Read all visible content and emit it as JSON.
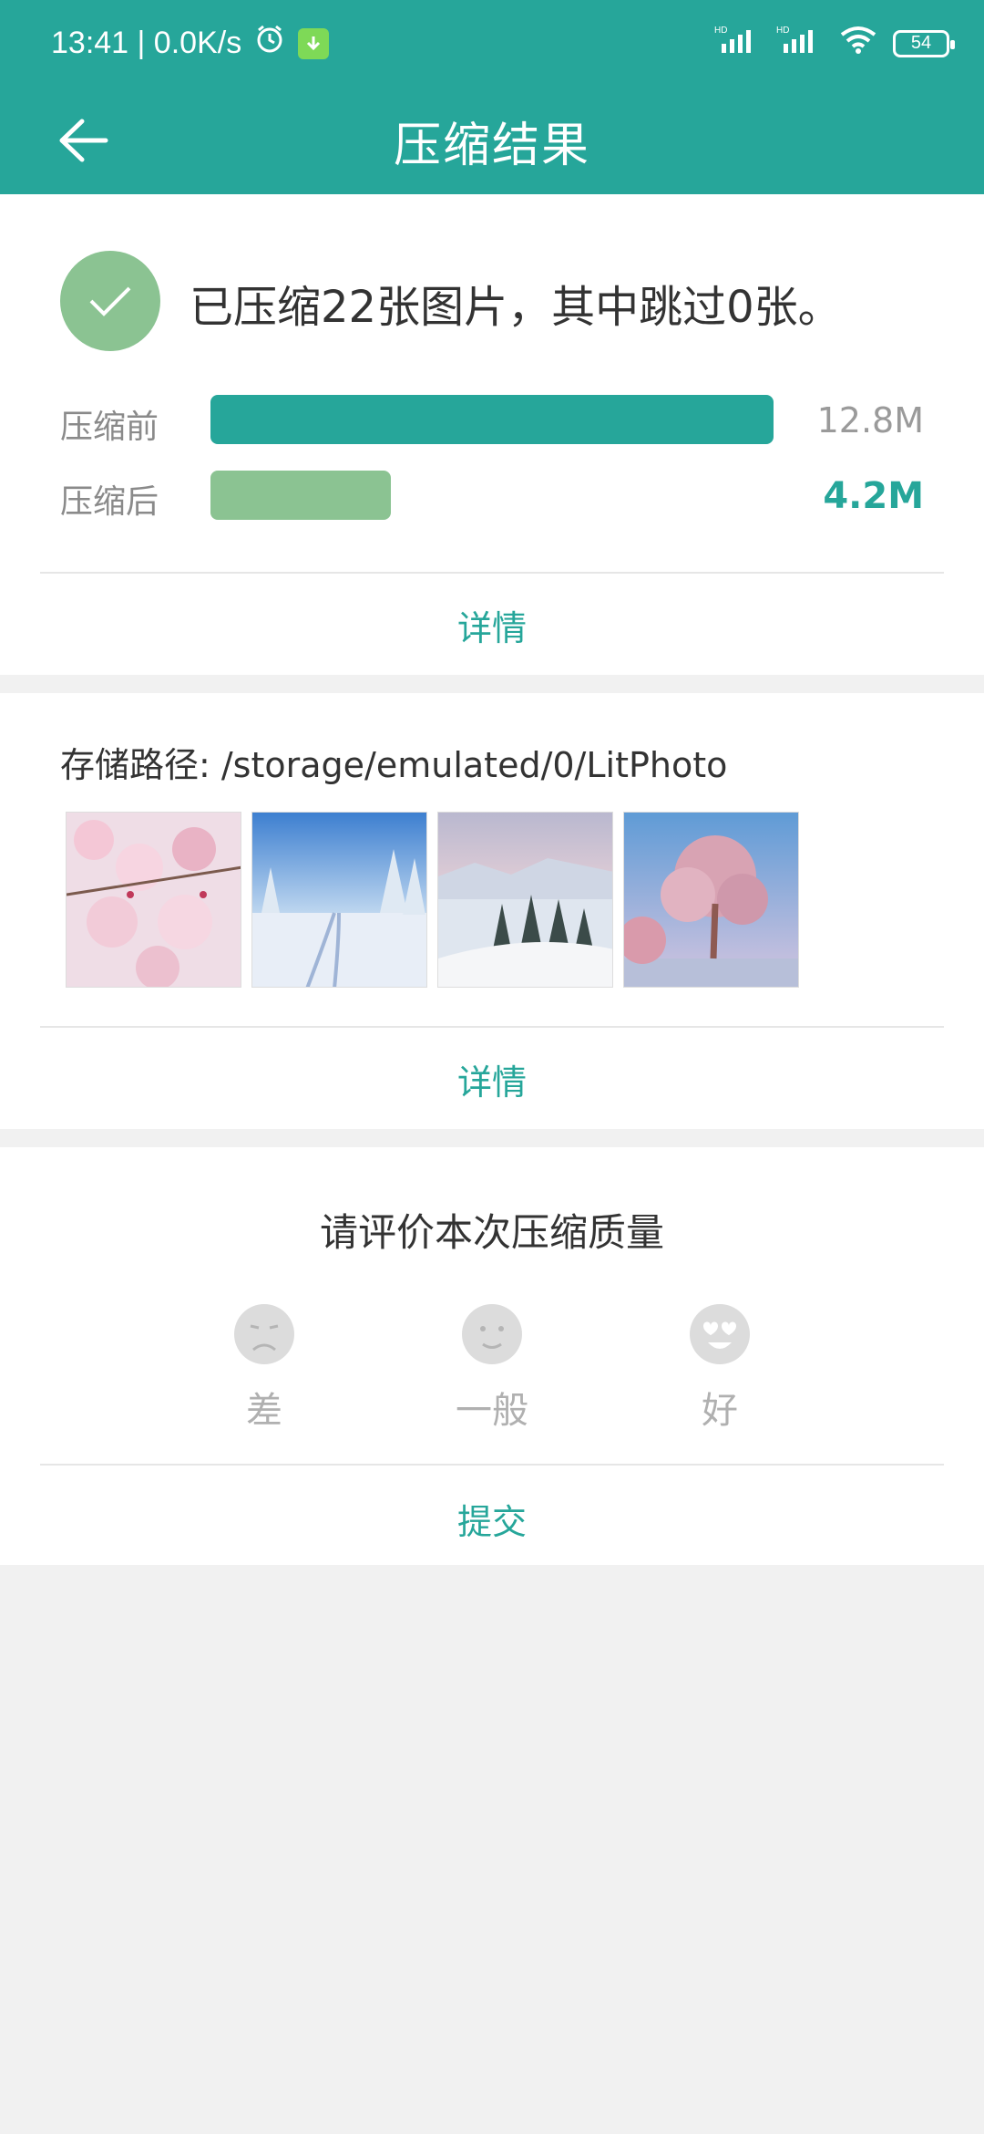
{
  "status_bar": {
    "time_speed": "13:41 | 0.0K/s",
    "battery": "54",
    "signal1": "HD",
    "signal2": "HD"
  },
  "appbar": {
    "title": "压缩结果"
  },
  "result": {
    "summary": "已压缩22张图片，其中跳过0张。",
    "before_label": "压缩前",
    "before_size": "12.8M",
    "after_label": "压缩后",
    "after_size": "4.2M",
    "details_link": "详情"
  },
  "storage": {
    "path": "存储路径:   /storage/emulated/0/LitPhoto",
    "details_link": "详情"
  },
  "rating": {
    "title": "请评价本次压缩质量",
    "options": [
      {
        "label": "差"
      },
      {
        "label": "一般"
      },
      {
        "label": "好"
      }
    ],
    "submit": "提交"
  },
  "colors": {
    "primary": "#26a69a",
    "accent_green": "#8bc392",
    "background": "#f1f1f1"
  }
}
